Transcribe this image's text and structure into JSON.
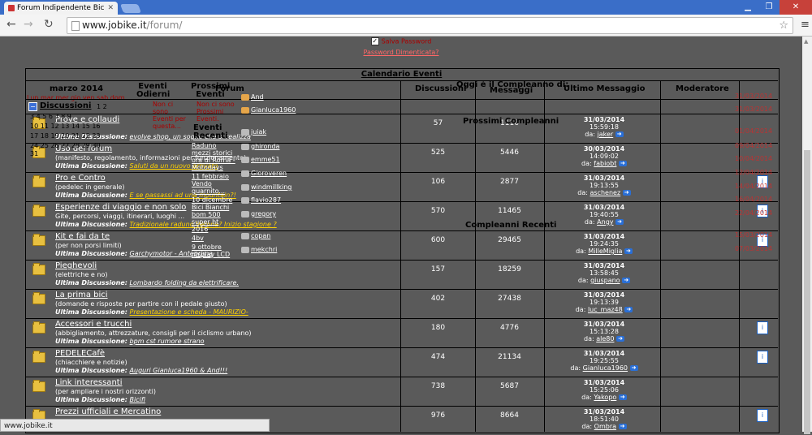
{
  "browser": {
    "tab_title": "Forum Indipendente Bicic",
    "url_host": "www.jobike.it",
    "url_path": "/forum/",
    "status_url": "www.jobike.it"
  },
  "login": {
    "save_password": "Salva Password",
    "forgot_password": "Password Dimenticata?"
  },
  "calendar": {
    "title": "Calendario Eventi",
    "month": "marzo 2014",
    "events_today": "Eventi Odierni",
    "upcoming_events": "Prossimi Eventi",
    "recent_events": "Eventi Recenti",
    "no_events": "Non ci sono Eventi per questa...",
    "no_upcoming": "Non ci sono Prossimi Eventi.",
    "birthday_today": "Oggi è il Compleanno di:",
    "upcoming_birthdays": "Prossimi Compleanni",
    "recent_birthdays": "Compleanni Recenti",
    "overlay_top_text": "Lun mar mer gio ven sab dom",
    "days_row1": "1 2",
    "days_row2": "3 4 5 6 7 8 9",
    "days_row3": "10 11 12 13 14 15 16",
    "days_row4": "17 18 19 20 21 22 23",
    "days_row5": "24 25 26 27 28 29 30",
    "days_row6": "31",
    "recent_list": [
      "Raduno mezzi storici ora di Roma - Motodays",
      "11 febbraio Vendo guarnito...",
      "10 dicembre Bici Bianchi bom 500 super ht 2016",
      "4bv",
      "9 ottobre display LCD"
    ],
    "birthday_users": [
      "And",
      "Gianluca1960",
      "juiak",
      "ghironda",
      "emme51",
      "Gioroveren",
      "windmillking",
      "flavio287",
      "gregory",
      "copan",
      "mekchri"
    ],
    "right_dates": [
      "31/03/2014",
      "31/03/2014",
      "01/04/2014",
      "09/04/2014",
      "10/04/2014",
      "12/04/2014",
      "14/04/2014",
      "16/04/2014",
      "22/04/2014",
      "15/03/2014",
      "07/03/2014"
    ]
  },
  "table": {
    "col_forum": "Forum",
    "col_discussions": "Discussioni",
    "col_messages": "Messaggi",
    "col_last": "Ultimo Messaggio",
    "col_mod": "Moderatore",
    "category": "Discussioni",
    "category_pages": "1  2",
    "last_label": "Ultima Discussione:",
    "by_label": "da:",
    "rows": [
      {
        "title": "Prove e collaudi",
        "desc": "",
        "last_topic": "evolve shop, un sogno che si realizza",
        "disc": "57",
        "msgs": "1116",
        "date": "31/03/2014",
        "time": "15:59:18",
        "user": "jaker",
        "mod": false
      },
      {
        "title": "Uso del forum",
        "desc": "(manifesto, regolamento, informazioni per funzionamento)",
        "last_topic": "Saluti da un nuovo arrivato",
        "disc": "525",
        "msgs": "5446",
        "date": "30/03/2014",
        "time": "14:09:02",
        "user": "fabiobt",
        "mod": false
      },
      {
        "title": "Pro e Contro",
        "desc": "(pedelec in generale)",
        "last_topic": "E se passassi ad una mountain?!",
        "disc": "106",
        "msgs": "2877",
        "date": "31/03/2014",
        "time": "19:13:55",
        "user": "aschenez",
        "mod": true
      },
      {
        "title": "Esperienze di viaggio e non solo",
        "desc": "Gite, percorsi, viaggi, itinerari, luoghi ...",
        "last_topic": "Tradizionale raduno Verona? Inizio stagione ?",
        "disc": "570",
        "msgs": "11465",
        "date": "31/03/2014",
        "time": "19:40:55",
        "user": "Angy",
        "mod": true
      },
      {
        "title": "Kit e fai da te",
        "desc": "(per non porsi limiti)",
        "last_topic": "Garchymotor - Anteprima",
        "disc": "600",
        "msgs": "29465",
        "date": "31/03/2014",
        "time": "19:24:35",
        "user": "MilleMiglia",
        "mod": true
      },
      {
        "title": "Pieghevoli",
        "desc": "(elettriche e no)",
        "last_topic": "Lombardo folding da elettrificare.",
        "disc": "157",
        "msgs": "18259",
        "date": "31/03/2014",
        "time": "13:58:45",
        "user": "giuspano",
        "mod": false
      },
      {
        "title": "La prima bici",
        "desc": "(domande e risposte per partire con il pedale giusto)",
        "last_topic": "Presentazione e scheda - MAURIZIO-",
        "disc": "402",
        "msgs": "27438",
        "date": "31/03/2014",
        "time": "19:13:39",
        "user": "luc_maz48",
        "mod": false
      },
      {
        "title": "Accessori e trucchi",
        "desc": "(abbigliamento, attrezzature, consigli per il ciclismo urbano)",
        "last_topic": "bpm cst rumore strano",
        "disc": "180",
        "msgs": "4776",
        "date": "31/03/2014",
        "time": "15:13:28",
        "user": "ale80",
        "mod": true
      },
      {
        "title": "PEDELECafè",
        "desc": "(chiacchiere e notizie)",
        "last_topic": "Auguri Gianluca1960 & And!!!",
        "disc": "474",
        "msgs": "21134",
        "date": "31/03/2014",
        "time": "19:25:55",
        "user": "Gianluca1960",
        "mod": true
      },
      {
        "title": "Link interessanti",
        "desc": "(per ampliare i nostri orizzonti)",
        "last_topic": "Bicifi",
        "disc": "738",
        "msgs": "5687",
        "date": "31/03/2014",
        "time": "15:25:06",
        "user": "Yakopo",
        "mod": false
      },
      {
        "title": "Prezzi ufficiali e Mercatino",
        "desc": "",
        "last_topic": "",
        "disc": "976",
        "msgs": "8664",
        "date": "31/03/2014",
        "time": "18:51:40",
        "user": "Ombra",
        "mod": true
      }
    ]
  }
}
